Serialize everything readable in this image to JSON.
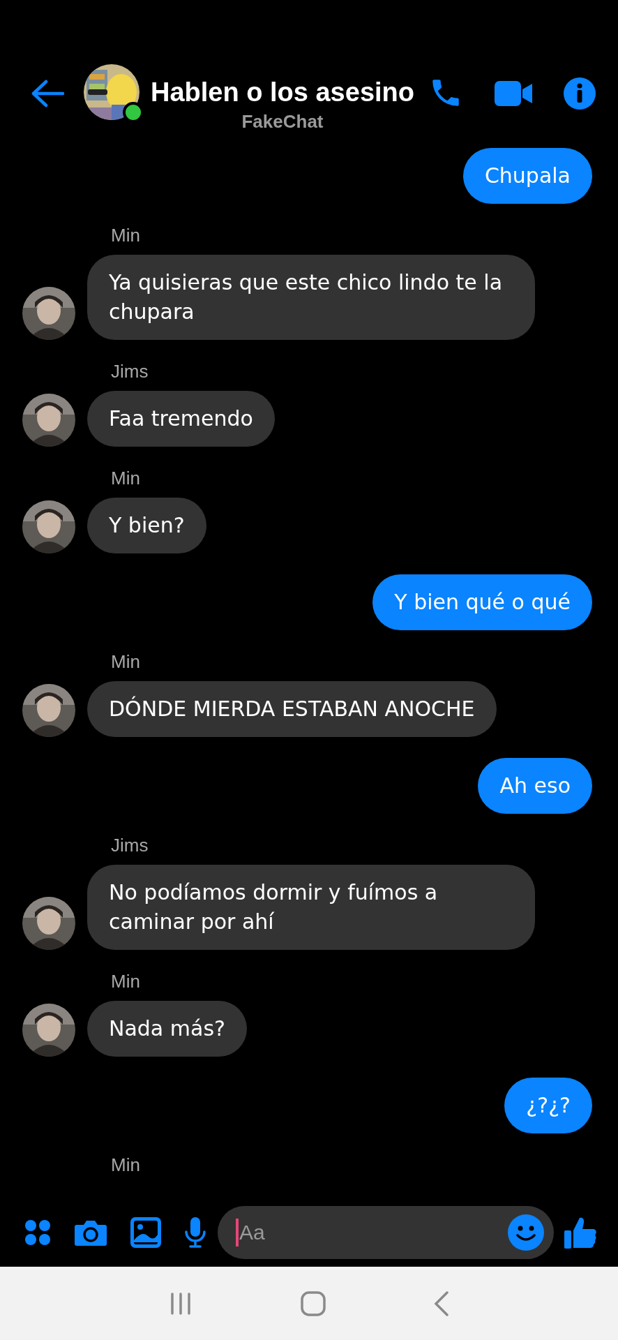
{
  "header": {
    "title": "Hablen o los asesino",
    "subtitle": "FakeChat",
    "online": true
  },
  "messages": [
    {
      "kind": "outgoing",
      "text": "Chupala"
    },
    {
      "kind": "incoming",
      "sender": "Min",
      "text": "Ya quisieras que este chico lindo te la chupara"
    },
    {
      "kind": "incoming",
      "sender": "Jims",
      "text": "Faa tremendo"
    },
    {
      "kind": "incoming",
      "sender": "Min",
      "text": "Y bien?"
    },
    {
      "kind": "outgoing",
      "text": "Y bien qué o qué"
    },
    {
      "kind": "incoming",
      "sender": "Min",
      "text": "DÓNDE MIERDA ESTABAN ANOCHE"
    },
    {
      "kind": "outgoing",
      "text": "Ah eso"
    },
    {
      "kind": "incoming",
      "sender": "Jims",
      "text": "No podíamos dormir y fuímos a caminar por ahí"
    },
    {
      "kind": "incoming",
      "sender": "Min",
      "text": "Nada más?"
    },
    {
      "kind": "outgoing",
      "text": "¿?¿?"
    },
    {
      "kind": "incoming",
      "sender": "Min"
    }
  ],
  "composer": {
    "placeholder": "Aa"
  }
}
